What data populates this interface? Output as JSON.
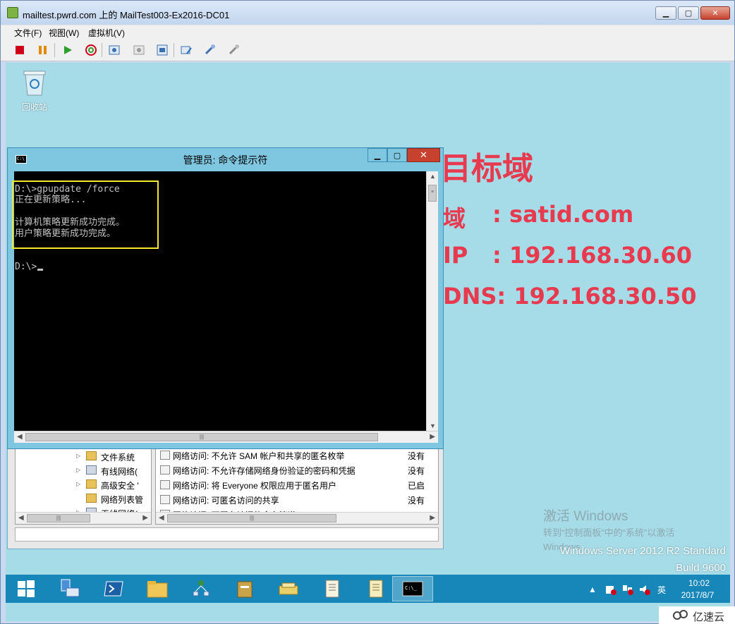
{
  "window": {
    "title": "mailtest.pwrd.com 上的 MailTest003-Ex2016-DC01",
    "menu": [
      "文件(F)",
      "视图(W)",
      "虚拟机(V)"
    ]
  },
  "toolbar": {
    "buttons": [
      "stop-icon",
      "pause-icon",
      "start-icon",
      "reset-icon",
      "snapshot-icon",
      "revert-snapshot-icon",
      "manage-snapshots-icon",
      "edit-settings-icon",
      "console-options-icon",
      "vm-tools-icon"
    ]
  },
  "desktop": {
    "recycle_bin_label": "回收站",
    "bginfo": {
      "heading": "目标域",
      "domain_label": "域",
      "domain_value": ": satid.com",
      "ip_label": "IP",
      "ip_value": ": 192.168.30.60",
      "dns_label": "DNS: 192.168.30.50"
    },
    "activation": {
      "title": "激活 Windows",
      "subtitle": "转到“控制面板”中的“系统”以激活",
      "subtitle2": "Windows。"
    },
    "server_edition": "Windows Server 2012 R2 Standard",
    "server_build": "Build 9600"
  },
  "mmc": {
    "tree": [
      "文件系统",
      "有线网络(",
      "高级安全 '",
      "网络列表管",
      "无线网络("
    ],
    "list": [
      {
        "name": "网络访问: 不允许 SAM 帐户和共享的匿名枚举",
        "value": "没有"
      },
      {
        "name": "网络访问: 不允许存储网络身份验证的密码和凭据",
        "value": "没有"
      },
      {
        "name": "网络访问: 将 Everyone 权限应用于匿名用户",
        "value": "已启"
      },
      {
        "name": "网络访问: 可匿名访问的共享",
        "value": "没有"
      },
      {
        "name": "网络访问: 可匿名访问的命名管道",
        "value": ""
      }
    ]
  },
  "cmd": {
    "title": "管理员: 命令提示符",
    "lines": [
      "D:\\>gpupdate /force",
      "正在更新策略...",
      "",
      "计算机策略更新成功完成。",
      "用户策略更新成功完成。",
      "",
      "",
      "D:\\>"
    ]
  },
  "taskbar": {
    "apps": [
      "start-icon",
      "server-manager-icon",
      "powershell-icon",
      "file-explorer-icon",
      "network-icon",
      "group-policy-icon",
      "tools-icon",
      "notepad-icon",
      "document-icon",
      "command-prompt-icon"
    ],
    "tray": {
      "ime": "英",
      "time": "10:02",
      "date": "2017/8/7"
    }
  },
  "watermark": "亿速云",
  "colors": {
    "desktop": "#a6dbe8",
    "taskbar": "#1687b8",
    "bginfo_text": "#e83a4f",
    "highlight": "#f2e72d"
  }
}
